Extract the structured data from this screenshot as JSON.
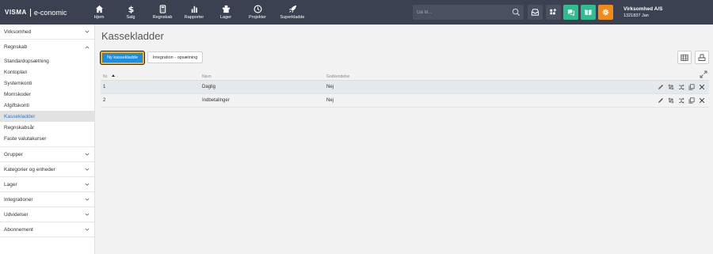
{
  "brand": {
    "mark": "VISMA",
    "product": "e-conomic"
  },
  "nav": [
    {
      "label": "Hjem",
      "icon": "home-icon"
    },
    {
      "label": "Salg",
      "icon": "dollar-icon"
    },
    {
      "label": "Regnskab",
      "icon": "calculator-icon"
    },
    {
      "label": "Rapporter",
      "icon": "bar-chart-icon"
    },
    {
      "label": "Lager",
      "icon": "box-icon"
    },
    {
      "label": "Projekter",
      "icon": "clock-icon"
    },
    {
      "label": "Superkladde",
      "icon": "rocket-icon"
    }
  ],
  "search": {
    "placeholder": "Gå til..."
  },
  "company": {
    "name": "Virksomhed A/S",
    "user": "1321837 Jan"
  },
  "colors": {
    "topbar": "#3b4150",
    "accent": "#1f8ce3",
    "highlight": "#f2b40a",
    "chat": "#2dbd8f",
    "book": "#2dbd8f",
    "settings": "#f28a18",
    "active_link": "#2a7cc7"
  },
  "sidebar": {
    "sections": [
      {
        "title": "Virksomhed"
      },
      {
        "title": "Regnskab"
      },
      {
        "title": "Grupper"
      },
      {
        "title": "Kategorier og enheder"
      },
      {
        "title": "Lager"
      },
      {
        "title": "Integrationer"
      },
      {
        "title": "Udvidelser"
      },
      {
        "title": "Abonnement"
      }
    ],
    "regnskab_items": [
      "Standardopsætning",
      "Kontoplan",
      "Systemkonti",
      "Momskoder",
      "Afgiftskonti",
      "Kassekladder",
      "Regnskabsår",
      "Faste valutakurser"
    ],
    "active_item": "Kassekladder"
  },
  "page": {
    "title": "Kassekladder",
    "new_button": "Ny kassekladde",
    "integration_button": "Integration - opsætning"
  },
  "table": {
    "headers": {
      "no": "Nr.",
      "name": "Navn",
      "approval": "Godkendelse"
    },
    "rows": [
      {
        "no": "1",
        "name": "Daglig",
        "approval": "Nej"
      },
      {
        "no": "2",
        "name": "Indbetalinger",
        "approval": "Nej"
      }
    ]
  }
}
